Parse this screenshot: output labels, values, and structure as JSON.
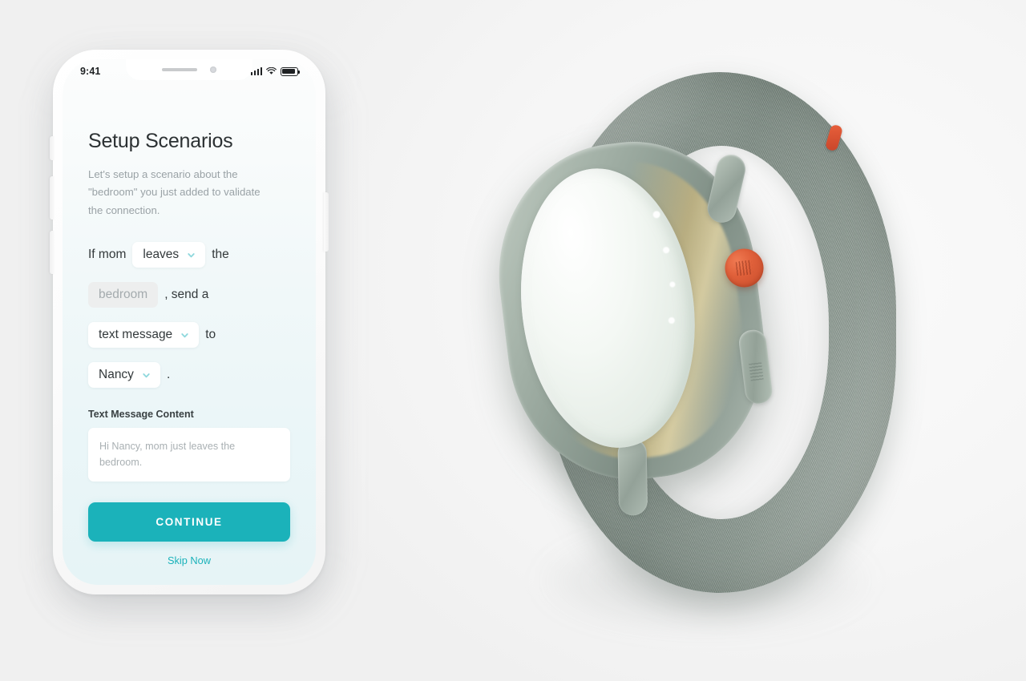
{
  "scene": {
    "background_color": "#fdfdfd",
    "description": "Product mockup: smartphone app screen beside a sage green smartwatch"
  },
  "phone": {
    "status_bar": {
      "time": "9:41",
      "signal_icon": "cellular-signal-icon",
      "wifi_icon": "wifi-icon",
      "battery_icon": "battery-icon"
    },
    "screen": {
      "title": "Setup Scenarios",
      "subtitle": "Let's setup a scenario about the \"bedroom\" you just added to validate the connection.",
      "sentence": {
        "word_if_mom": "If mom",
        "trigger_value": "leaves",
        "word_the": "the",
        "room_value": "bedroom",
        "word_send_a": ", send a",
        "action_value": "text message",
        "word_to": "to",
        "recipient_value": "Nancy",
        "word_period": "."
      },
      "message_field": {
        "label": "Text Message Content",
        "placeholder": "Hi Nancy, mom just leaves the bedroom.",
        "value": ""
      },
      "continue_label": "CONTINUE",
      "skip_label": "Skip Now",
      "accent_color": "#1bb2ba",
      "background_gradient_top": "#fcfdfd",
      "background_gradient_bottom": "#e6f4f6"
    }
  },
  "watch": {
    "case_color": "#93a298",
    "band_color": "#8d9a92",
    "crown_color": "#e0603a",
    "face_color": "#eef4ef",
    "band_tab_color": "#d8522f"
  }
}
